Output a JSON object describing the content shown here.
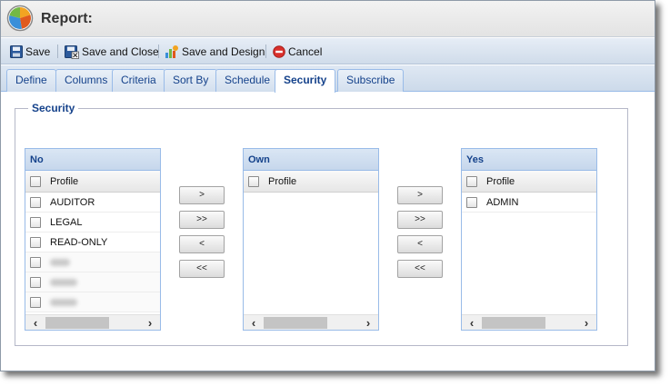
{
  "window": {
    "title": "Report:"
  },
  "toolbar": {
    "save": "Save",
    "save_close": "Save and Close",
    "save_design": "Save and Design",
    "cancel": "Cancel"
  },
  "tabs": [
    {
      "label": "Define"
    },
    {
      "label": "Columns"
    },
    {
      "label": "Criteria"
    },
    {
      "label": "Sort By"
    },
    {
      "label": "Schedule"
    },
    {
      "label": "Security",
      "active": true
    },
    {
      "label": "Subscribe"
    }
  ],
  "security": {
    "legend": "Security",
    "grids": {
      "no": {
        "title": "No",
        "column": "Profile",
        "rows": [
          "AUDITOR",
          "LEGAL",
          "READ-ONLY"
        ]
      },
      "own": {
        "title": "Own",
        "column": "Profile",
        "rows": []
      },
      "yes": {
        "title": "Yes",
        "column": "Profile",
        "rows": [
          "ADMIN"
        ]
      }
    },
    "move_buttons": {
      "move_one_right": ">",
      "move_all_right": ">>",
      "move_one_left": "<",
      "move_all_left": "<<"
    }
  },
  "icons": {
    "logo": "pie-chart-logo-icon",
    "save": "floppy-disk-icon",
    "save_close": "floppy-disk-close-icon",
    "save_design": "design-tool-icon",
    "cancel": "cancel-circle-icon",
    "scroll_left": "chevron-left-icon",
    "scroll_right": "chevron-right-icon"
  },
  "colors": {
    "header_text": "#15428b",
    "grid_border": "#99bbe8",
    "cancel_red": "#d9302c"
  }
}
